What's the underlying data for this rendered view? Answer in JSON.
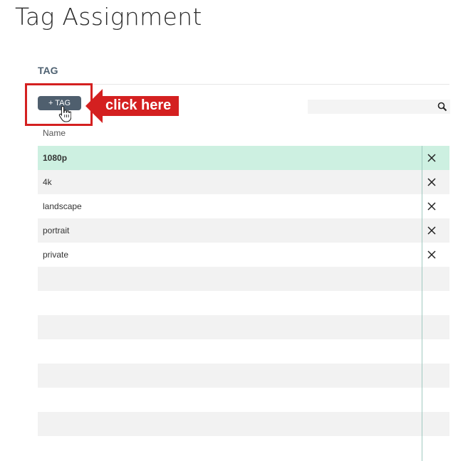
{
  "page": {
    "title": "Tag Assignment"
  },
  "section": {
    "label": "TAG"
  },
  "toolbar": {
    "add_tag_label": "+ TAG"
  },
  "annotation": {
    "callout_text": "click here",
    "callout_color": "#d42020"
  },
  "search": {
    "placeholder": "",
    "value": ""
  },
  "table": {
    "column_header": "Name",
    "rows": [
      {
        "name": "1080p",
        "selected": true
      },
      {
        "name": "4k"
      },
      {
        "name": "landscape"
      },
      {
        "name": "portrait"
      },
      {
        "name": "private"
      }
    ],
    "empty_row_count": 7
  },
  "colors": {
    "button_bg": "#4f5f6e",
    "selected_row": "#cdf0e1",
    "alt_row": "#f2f2f2",
    "divider": "#9fc9c0"
  },
  "icons": {
    "remove": "close-icon",
    "search": "search-icon",
    "cursor": "hand-pointer-icon"
  }
}
